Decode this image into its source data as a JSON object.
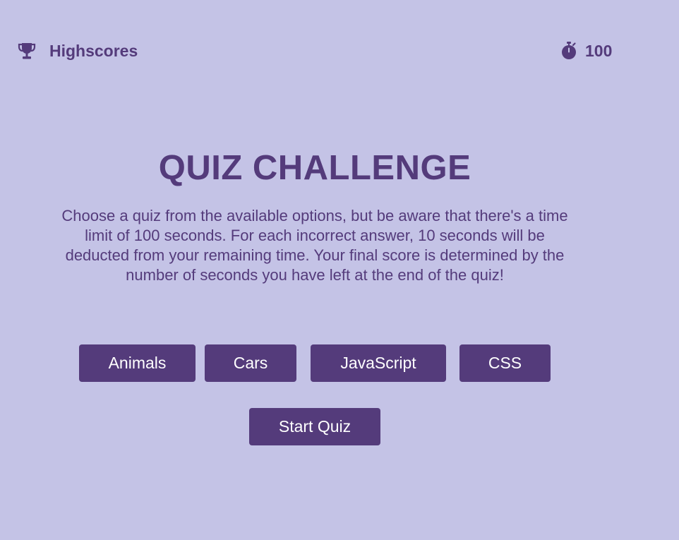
{
  "header": {
    "highscores_label": "Highscores",
    "highscores_icon": "trophy-icon",
    "timer_icon": "stopwatch-icon",
    "timer_value": "100"
  },
  "main": {
    "title": "QUIZ CHALLENGE",
    "description": "Choose a quiz from the available options, but be aware that there's a time limit of 100 seconds. For each incorrect answer, 10 seconds will be deducted from your remaining time. Your final score is determined by the number of seconds you have left at the end of the quiz!",
    "quiz_options": [
      "Animals",
      "Cars",
      "JavaScript",
      "CSS"
    ],
    "start_label": "Start Quiz"
  },
  "colors": {
    "background": "#c4c3e6",
    "accent": "#543b7b",
    "button_text": "#ffffff"
  }
}
